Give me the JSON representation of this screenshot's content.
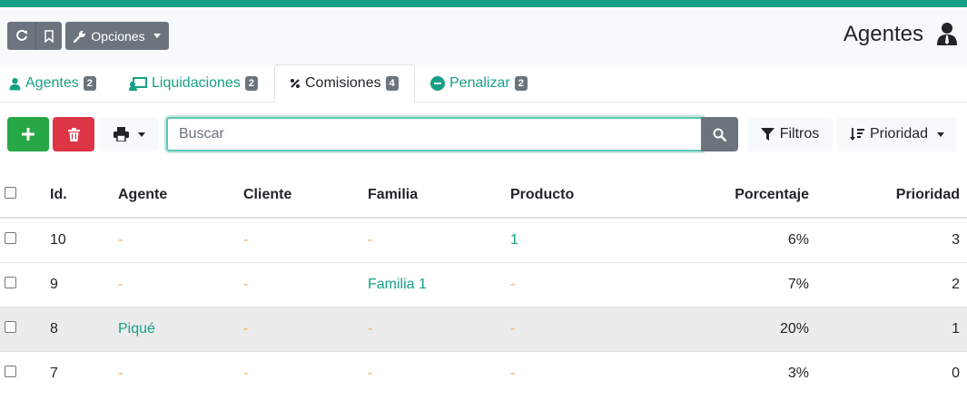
{
  "colors": {
    "accent": "#16a085",
    "success": "#28a745",
    "danger": "#dc3545",
    "secondary": "#6c757d",
    "warning_text": "#f0ad4e",
    "row_highlight": "#ececec"
  },
  "header": {
    "reload_icon": "reload-icon",
    "bookmark_icon": "bookmark-icon",
    "options_label": "Opciones",
    "options_icon": "wrench-icon",
    "title": "Agentes",
    "title_icon": "user-tie-icon"
  },
  "tabs": [
    {
      "label": "Agentes",
      "badge": "2",
      "icon": "user-tie-icon",
      "active": false
    },
    {
      "label": "Liquidaciones",
      "badge": "2",
      "icon": "chalkboard-teacher-icon",
      "active": false
    },
    {
      "label": "Comisiones",
      "badge": "4",
      "icon": "percentage-icon",
      "active": true
    },
    {
      "label": "Penalizar",
      "badge": "2",
      "icon": "minus-circle-icon",
      "active": false
    }
  ],
  "toolbar": {
    "add_icon": "plus-icon",
    "delete_icon": "trash-icon",
    "print_icon": "print-icon",
    "search_placeholder": "Buscar",
    "search_value": "",
    "filters_label": "Filtros",
    "priority_label": "Prioridad"
  },
  "table": {
    "columns": [
      "Id.",
      "Agente",
      "Cliente",
      "Familia",
      "Producto",
      "Porcentaje",
      "Prioridad"
    ],
    "rows": [
      {
        "id": "10",
        "agent": "-",
        "client": "-",
        "family": "-",
        "product": "1",
        "percentage": "6%",
        "priority": "3"
      },
      {
        "id": "9",
        "agent": "-",
        "client": "-",
        "family": "Familia 1",
        "product": "-",
        "percentage": "7%",
        "priority": "2"
      },
      {
        "id": "8",
        "agent": "Piqué",
        "client": "-",
        "family": "-",
        "product": "-",
        "percentage": "20%",
        "priority": "1"
      },
      {
        "id": "7",
        "agent": "-",
        "client": "-",
        "family": "-",
        "product": "-",
        "percentage": "3%",
        "priority": "0"
      }
    ]
  }
}
